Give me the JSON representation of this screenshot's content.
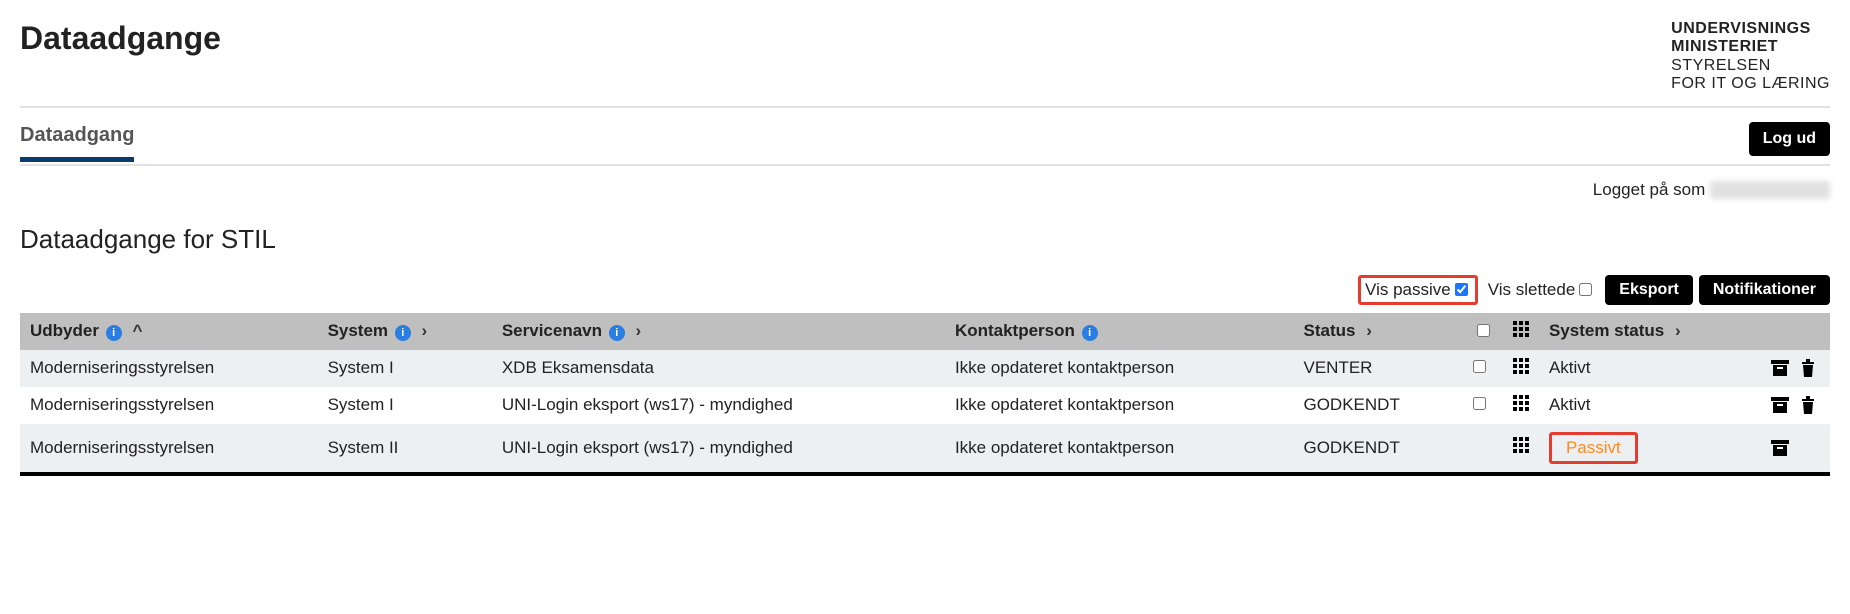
{
  "brand": {
    "line1": "UNDERVISNINGS",
    "line2": "MINISTERIET",
    "line3": "STYRELSEN",
    "line4": "FOR IT OG LÆRING"
  },
  "page_title": "Dataadgange",
  "tabs": {
    "dataadgang": "Dataadgang"
  },
  "logout_label": "Log ud",
  "logged_in_prefix": "Logget på som",
  "section_heading": "Dataadgange for STIL",
  "filters": {
    "show_passive_label": "Vis passive",
    "show_passive_checked": true,
    "show_deleted_label": "Vis slettede",
    "show_deleted_checked": false
  },
  "buttons": {
    "export": "Eksport",
    "notifications": "Notifikationer"
  },
  "columns": {
    "udbyder": "Udbyder",
    "system": "System",
    "servicenavn": "Servicenavn",
    "kontaktperson": "Kontaktperson",
    "status": "Status",
    "system_status": "System status"
  },
  "rows": [
    {
      "udbyder": "Moderniseringsstyrelsen",
      "system": "System I",
      "servicenavn": "XDB Eksamensdata",
      "kontaktperson": "Ikke opdateret kontaktperson",
      "status": "VENTER",
      "system_status": "Aktivt",
      "show_checkbox": true,
      "show_trash": true,
      "passive": false
    },
    {
      "udbyder": "Moderniseringsstyrelsen",
      "system": "System I",
      "servicenavn": "UNI-Login eksport (ws17) - myndighed",
      "kontaktperson": "Ikke opdateret kontaktperson",
      "status": "GODKENDT",
      "system_status": "Aktivt",
      "show_checkbox": true,
      "show_trash": true,
      "passive": false
    },
    {
      "udbyder": "Moderniseringsstyrelsen",
      "system": "System II",
      "servicenavn": "UNI-Login eksport (ws17) - myndighed",
      "kontaktperson": "Ikke opdateret kontaktperson",
      "status": "GODKENDT",
      "system_status": "Passivt",
      "show_checkbox": false,
      "show_trash": false,
      "passive": true
    }
  ]
}
